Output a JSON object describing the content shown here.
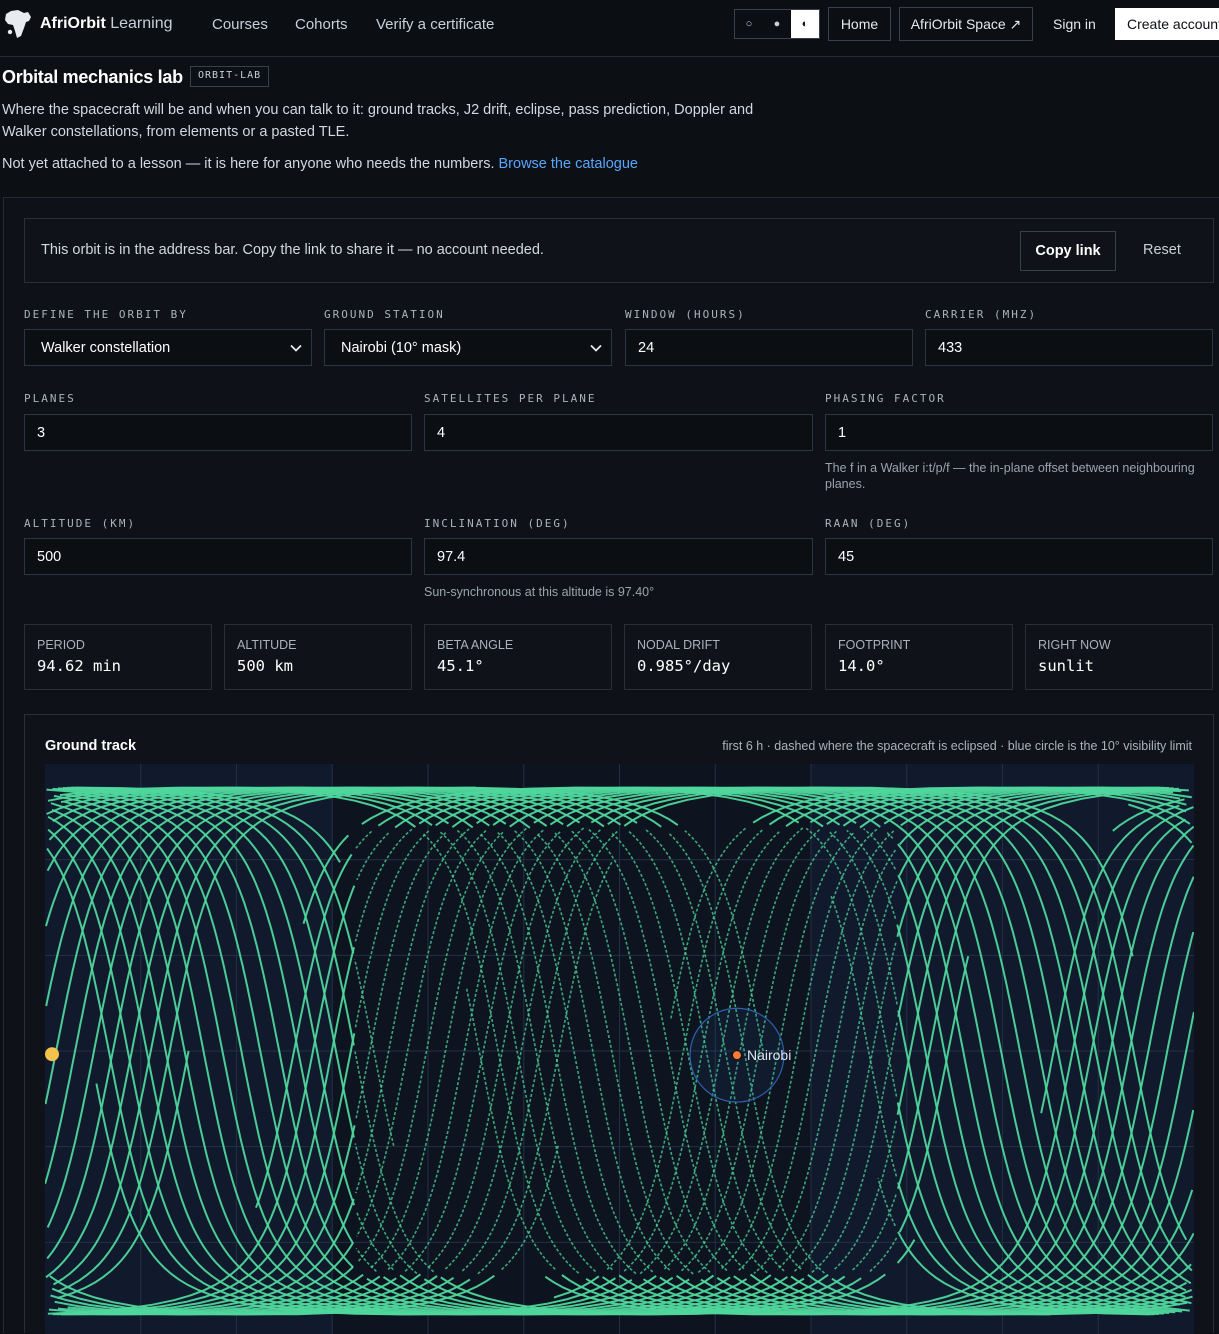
{
  "brand": {
    "name_bold": "AfriOrbit",
    "name_rest": "Learning"
  },
  "nav": {
    "courses": "Courses",
    "cohorts": "Cohorts",
    "verify": "Verify a certificate"
  },
  "theme": {
    "options": [
      "○",
      "●",
      "◐"
    ],
    "selected": 2
  },
  "header": {
    "home": "Home",
    "space": "AfriOrbit Space ↗",
    "signin": "Sign in",
    "create": "Create account"
  },
  "page": {
    "title": "Orbital mechanics lab",
    "tag": "ORBIT-LAB",
    "description": "Where the spacecraft will be and when you can talk to it: ground tracks, J2 drift, eclipse, pass prediction, Doppler and Walker constellations, from elements or a pasted TLE.",
    "note": "Not yet attached to a lesson — it is here for anyone who needs the numbers.",
    "note_link": "Browse the catalogue"
  },
  "share": {
    "text": "This orbit is in the address bar. Copy the link to share it — no account needed.",
    "copy": "Copy link",
    "reset": "Reset"
  },
  "form": {
    "define_by": {
      "label": "DEFINE THE ORBIT BY",
      "value": "Walker constellation"
    },
    "station": {
      "label": "GROUND STATION",
      "value": "Nairobi (10° mask)"
    },
    "window": {
      "label": "WINDOW (HOURS)",
      "value": "24"
    },
    "carrier": {
      "label": "CARRIER (MHZ)",
      "value": "433"
    },
    "planes": {
      "label": "PLANES",
      "value": "3"
    },
    "sats": {
      "label": "SATELLITES PER PLANE",
      "value": "4"
    },
    "phasing": {
      "label": "PHASING FACTOR",
      "value": "1",
      "hint": "The f in a Walker i:t/p/f — the in-plane offset between neighbouring planes."
    },
    "altitude": {
      "label": "ALTITUDE (KM)",
      "value": "500"
    },
    "inclination": {
      "label": "INCLINATION (DEG)",
      "value": "97.4",
      "hint": "Sun-synchronous at this altitude is 97.40°"
    },
    "raan": {
      "label": "RAAN (DEG)",
      "value": "45"
    }
  },
  "stats": [
    {
      "label": "PERIOD",
      "value": "94.62 min"
    },
    {
      "label": "ALTITUDE",
      "value": "500 km"
    },
    {
      "label": "BETA ANGLE",
      "value": "45.1°"
    },
    {
      "label": "NODAL DRIFT",
      "value": "0.985°/day"
    },
    {
      "label": "FOOTPRINT",
      "value": "14.0°"
    },
    {
      "label": "RIGHT NOW",
      "value": "sunlit"
    }
  ],
  "ground_track": {
    "title": "Ground track",
    "caption": "first 6 h · dashed where the spacecraft is eclipsed · blue circle is the 10° visibility limit",
    "station_label": "Nairobi",
    "station_lon": 36.8,
    "station_lat": -1.3,
    "visibility_radius_deg": 14.0,
    "track_hours": 6,
    "inclination_deg": 97.4,
    "period_min": 94.62,
    "planes": 3,
    "sats_per_plane": 4,
    "phasing": 1,
    "raan_deg": 45,
    "subsolar_lon": -178,
    "colors": {
      "track": "#4fd69c",
      "station": "#ff7a33",
      "circle": "#2f5fae",
      "sun": "#f2c14e",
      "grid": "#223046",
      "night": "#111a2c",
      "day": "#0d141f"
    }
  }
}
